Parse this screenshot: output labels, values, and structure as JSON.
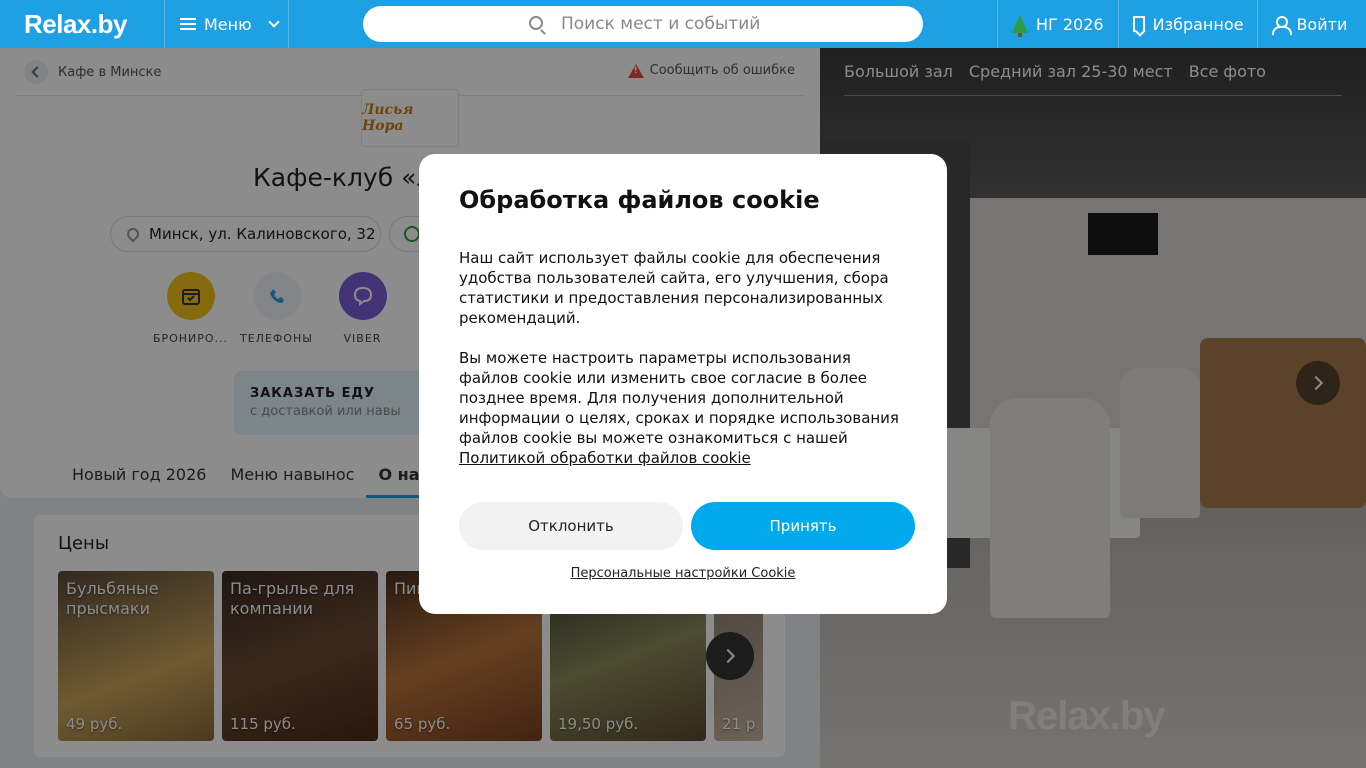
{
  "header": {
    "logo": "Relax.by",
    "menu_label": "Меню",
    "search_placeholder": "Поиск мест и событий",
    "ny_label": "НГ 2026",
    "favorites_label": "Избранное",
    "login_label": "Войти",
    "colors": {
      "bar": "#1ea0e4"
    }
  },
  "page": {
    "back_label": "Кафе в Минске",
    "report_label": "Сообщить об ошибке",
    "venue_logo_text": "Лисья Нора",
    "title": "Кафе-клуб «Л",
    "address": "Минск, ул. Калиновского, 32",
    "actions": [
      {
        "label": "БРОНИРО...",
        "color": "#f2c31b",
        "icon": "calendar-icon"
      },
      {
        "label": "ТЕЛЕФОНЫ",
        "color": "#f0f2f5",
        "icon": "phone-icon"
      },
      {
        "label": "VIBER",
        "color": "#7b5bd6",
        "icon": "viber-icon"
      }
    ],
    "order": {
      "title": "ЗАКАЗАТЬ ЕДУ",
      "subtitle": "с доставкой или навы"
    },
    "tabs": [
      "Новый год 2026",
      "Меню навынос",
      "О нас"
    ]
  },
  "prices": {
    "heading": "Цены",
    "items": [
      {
        "name": "Бульбяные прысмаки",
        "price": "49 руб."
      },
      {
        "name": "Па-грылье для компании",
        "price": "115 руб."
      },
      {
        "name": "Пив комп",
        "price": "65 руб."
      },
      {
        "name": "",
        "price": "19,50 руб."
      },
      {
        "name": "",
        "price": "21 р"
      }
    ]
  },
  "gallery": {
    "tabs": [
      "Большой зал",
      "Средний зал 25-30 мест",
      "Все фото"
    ],
    "watermark": "Relax.by"
  },
  "cookie": {
    "title": "Обработка файлов cookie",
    "para1": "Наш сайт использует файлы cookie для обеспечения удобства пользователей сайта, его улучшения, сбора статистики и предоставления персонализированных рекомендаций.",
    "para2": "Вы можете настроить параметры использования файлов cookie или изменить свое согласие в более позднее время. Для получения дополнительной информации о целях, сроках и порядке использования файлов cookie вы можете ознакомиться с нашей",
    "policy_link": "Политикой обработки файлов cookie",
    "decline": "Отклонить",
    "accept": "Принять",
    "settings": "Персональные настройки Cookie",
    "accept_color": "#00a9ec"
  }
}
